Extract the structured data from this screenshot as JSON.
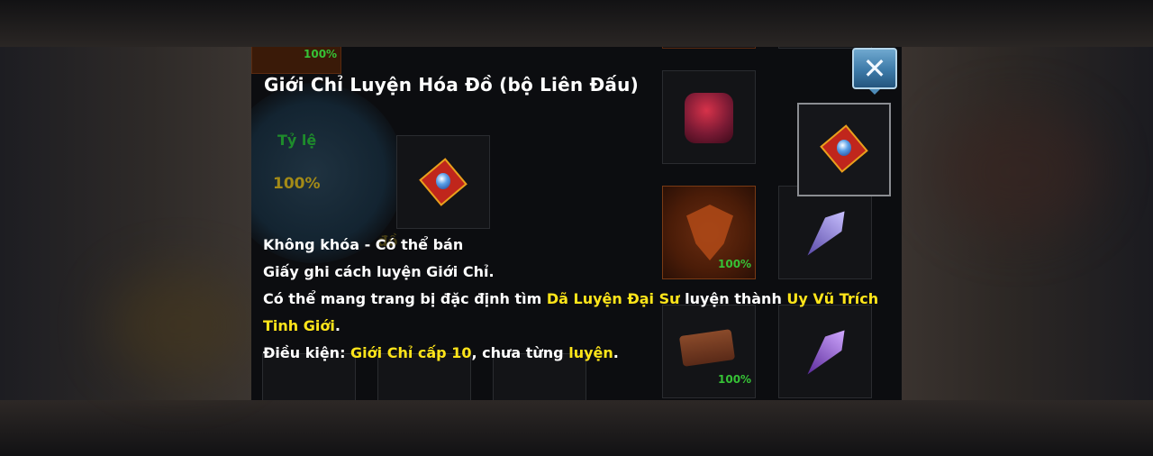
{
  "tooltip": {
    "title": "Giới Chỉ Luyện Hóa Đồ (bộ Liên Đấu)",
    "lock_status": "Không khóa - Có thể bán",
    "line1": "Giấy ghi cách luyện Giới Chỉ.",
    "line2_a": "Có thể mang trang bị đặc định tìm ",
    "line2_npc": "Dã Luyện Đại Sư",
    "line2_b": " luyện thành ",
    "line2_item_1": "Uy Vũ Trích",
    "line2_item_2": "Tinh Giới",
    "line2_end": ".",
    "cond_label": "Điều kiện: ",
    "cond_value": "Giới Chỉ cấp 10",
    "cond_mid": ", chưa từng ",
    "cond_word": "luyện",
    "cond_end": "."
  },
  "background": {
    "rate_label": "Tỷ lệ",
    "rate_value": "100%",
    "slot_pcts": [
      "100%",
      "100%",
      "100%"
    ],
    "ghost_text": "đồ"
  },
  "close_button": {
    "label": "✕",
    "icon": "close-icon"
  },
  "colors": {
    "highlight": "#ffe51a",
    "text": "#ffffff",
    "rate_green": "#1e8c2b",
    "pct_green": "#36c236"
  }
}
